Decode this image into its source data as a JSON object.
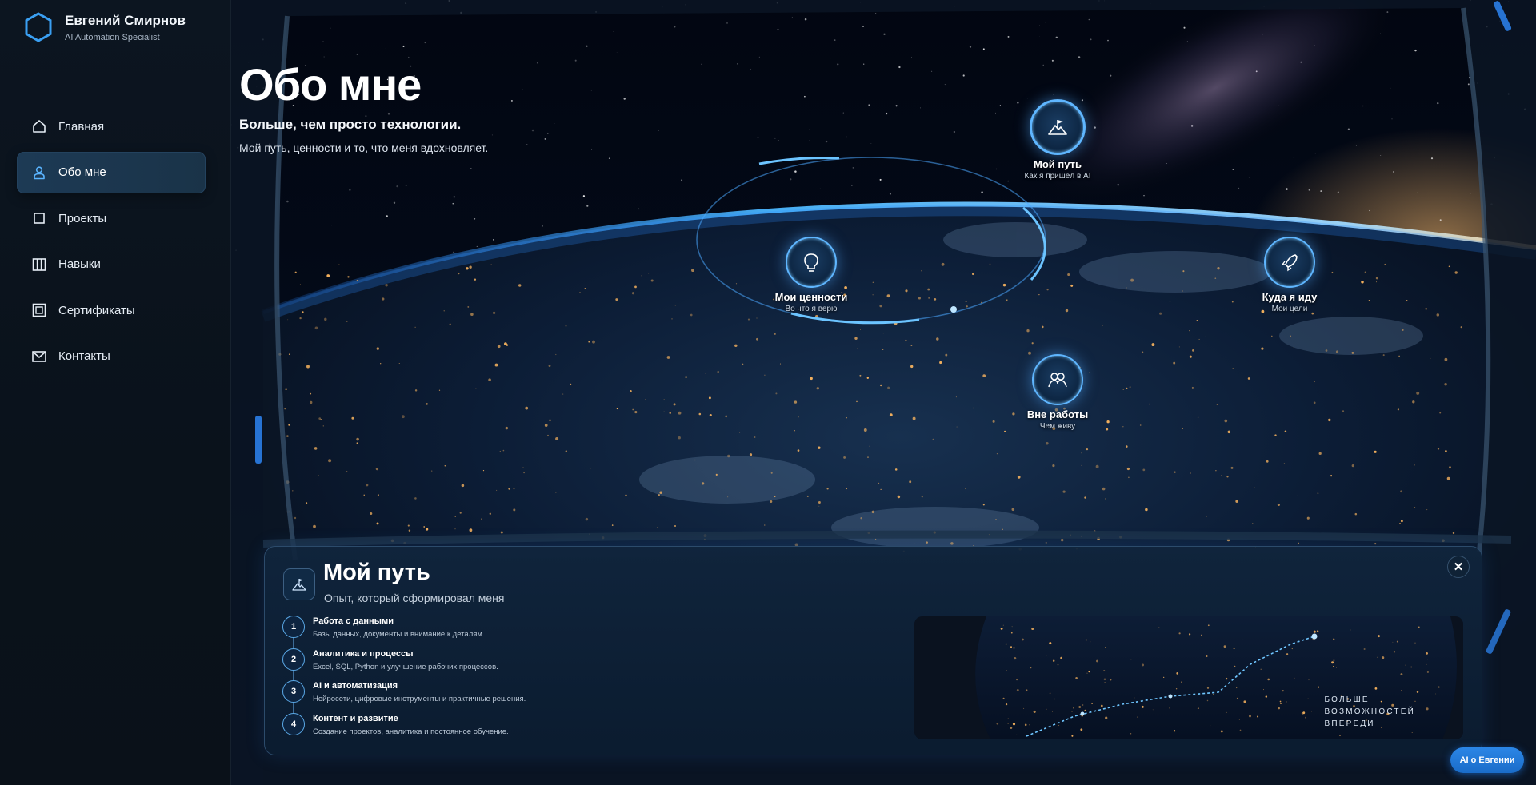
{
  "brand": {
    "name": "Евгений Смирнов",
    "role": "AI Automation Specialist"
  },
  "nav": {
    "items": [
      {
        "label": "Главная",
        "icon": "home-icon"
      },
      {
        "label": "Обо мне",
        "icon": "user-icon",
        "active": true
      },
      {
        "label": "Проекты",
        "icon": "square-icon"
      },
      {
        "label": "Навыки",
        "icon": "columns-icon"
      },
      {
        "label": "Сертификаты",
        "icon": "certificate-icon"
      },
      {
        "label": "Контакты",
        "icon": "mail-icon"
      }
    ]
  },
  "hero": {
    "title": "Обо мне",
    "subtitle": "Больше, чем просто технологии.",
    "description": "Мой путь, ценности и то, что меня вдохновляет."
  },
  "orbit_nodes": {
    "path": {
      "title": "Мой путь",
      "subtitle": "Как я пришёл в AI",
      "icon": "mountain-flag-icon"
    },
    "values": {
      "title": "Мои ценности",
      "subtitle": "Во что я верю",
      "icon": "lightbulb-icon"
    },
    "goals": {
      "title": "Куда я иду",
      "subtitle": "Мои цели",
      "icon": "rocket-icon"
    },
    "life": {
      "title": "Вне работы",
      "subtitle": "Чем живу",
      "icon": "people-icon"
    }
  },
  "panel": {
    "title": "Мой путь",
    "subtitle": "Опыт, который сформировал меня",
    "close_label": "✕",
    "steps": [
      {
        "num": "1",
        "title": "Работа с данными",
        "desc": "Базы данных, документы и внимание к деталям."
      },
      {
        "num": "2",
        "title": "Аналитика и процессы",
        "desc": "Excel, SQL, Python и улучшение рабочих процессов."
      },
      {
        "num": "3",
        "title": "AI и автоматизация",
        "desc": "Нейросети, цифровые инструменты и практичные решения."
      },
      {
        "num": "4",
        "title": "Контент и развитие",
        "desc": "Создание проектов, аналитика и постоянное обучение."
      }
    ],
    "image_caption": [
      "БОЛЬШЕ",
      "ВОЗМОЖНОСТЕЙ",
      "ВПЕРЕДИ"
    ]
  },
  "ai_button": {
    "label": "AI о Евгении"
  },
  "colors": {
    "accent": "#3aa0ff",
    "sidebar_bg": "#0c1520",
    "active_nav": "#1d3a55",
    "panel_bg": "#10253d"
  }
}
